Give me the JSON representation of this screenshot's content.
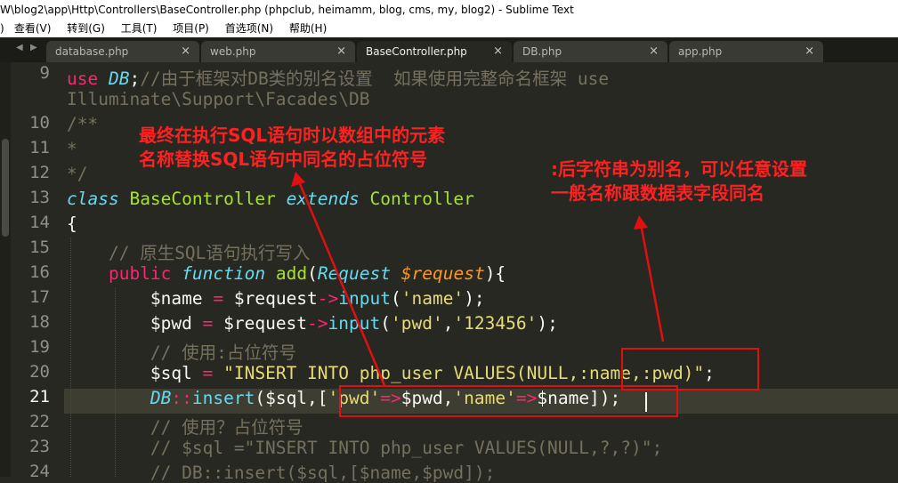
{
  "window": {
    "title": "W\\blog2\\app\\Http\\Controllers\\BaseController.php (phpclub, heimamm, blog, cms, my, blog2) - Sublime Text"
  },
  "menu": {
    "lead": ")",
    "items": [
      "查看(V)",
      "转到(G)",
      "工具(T)",
      "项目(P)",
      "首选项(N)",
      "帮助(H)"
    ]
  },
  "tabs": [
    {
      "label": "database.php",
      "close": "×"
    },
    {
      "label": "web.php",
      "close": "×"
    },
    {
      "label": "BaseController.php",
      "close": "×",
      "active": true
    },
    {
      "label": "DB.php",
      "close": "×"
    },
    {
      "label": "app.php",
      "close": "×"
    }
  ],
  "gutter": {
    "line_numbers": [
      "9",
      "",
      "10",
      "11",
      "12",
      "13",
      "14",
      "15",
      "16",
      "17",
      "18",
      "19",
      "20",
      "21",
      "22",
      "23",
      "24"
    ],
    "current_line": "21"
  },
  "code": {
    "lines": [
      [
        {
          "t": "use",
          "c": "k"
        },
        {
          "t": " "
        },
        {
          "t": "DB",
          "c": "t"
        },
        {
          "t": ";"
        },
        {
          "t": "//由于框架对DB类的别名设置  如果使用完整命名框架 use",
          "c": "c"
        }
      ],
      [
        {
          "t": "Illuminate\\Support\\Facades\\DB",
          "c": "c"
        }
      ],
      [
        {
          "t": "/**",
          "c": "c"
        }
      ],
      [
        {
          "t": "*",
          "c": "c"
        }
      ],
      [
        {
          "t": "*/",
          "c": "c"
        }
      ],
      [
        {
          "t": "class",
          "c": "t"
        },
        {
          "t": " "
        },
        {
          "t": "BaseController",
          "c": "g"
        },
        {
          "t": " "
        },
        {
          "t": "extends",
          "c": "t"
        },
        {
          "t": " "
        },
        {
          "t": "Controller",
          "c": "g"
        }
      ],
      [
        {
          "t": "{"
        }
      ],
      [
        {
          "t": "    "
        },
        {
          "t": "// 原生SQL语句执行写入",
          "c": "c"
        }
      ],
      [
        {
          "t": "    "
        },
        {
          "t": "public",
          "c": "k"
        },
        {
          "t": " "
        },
        {
          "t": "function",
          "c": "t"
        },
        {
          "t": " "
        },
        {
          "t": "add",
          "c": "g"
        },
        {
          "t": "("
        },
        {
          "t": "Request",
          "c": "t"
        },
        {
          "t": " "
        },
        {
          "t": "$request",
          "c": "p"
        },
        {
          "t": "){"
        }
      ],
      [
        {
          "t": "        $name "
        },
        {
          "t": "=",
          "c": "k"
        },
        {
          "t": " $request"
        },
        {
          "t": "->",
          "c": "k"
        },
        {
          "t": "input",
          "c": "f"
        },
        {
          "t": "("
        },
        {
          "t": "'name'",
          "c": "s"
        },
        {
          "t": ");"
        }
      ],
      [
        {
          "t": "        $pwd "
        },
        {
          "t": "=",
          "c": "k"
        },
        {
          "t": " $request"
        },
        {
          "t": "->",
          "c": "k"
        },
        {
          "t": "input",
          "c": "f"
        },
        {
          "t": "("
        },
        {
          "t": "'pwd'",
          "c": "s"
        },
        {
          "t": ","
        },
        {
          "t": "'123456'",
          "c": "s"
        },
        {
          "t": ");"
        }
      ],
      [
        {
          "t": "        "
        },
        {
          "t": "// 使用:占位符号",
          "c": "c"
        }
      ],
      [
        {
          "t": "        $sql "
        },
        {
          "t": "=",
          "c": "k"
        },
        {
          "t": " "
        },
        {
          "t": "\"INSERT INTO php_user VALUES(NULL,:name,:pwd)\"",
          "c": "s"
        },
        {
          "t": ";"
        }
      ],
      [
        {
          "t": "        "
        },
        {
          "t": "DB",
          "c": "t"
        },
        {
          "t": "::",
          "c": "k"
        },
        {
          "t": "insert",
          "c": "f"
        },
        {
          "t": "($sql,["
        },
        {
          "t": "'pwd'",
          "c": "s"
        },
        {
          "t": "=>",
          "c": "k"
        },
        {
          "t": "$pwd,"
        },
        {
          "t": "'name'",
          "c": "s"
        },
        {
          "t": "=>",
          "c": "k"
        },
        {
          "t": "$name]);"
        }
      ],
      [
        {
          "t": "        "
        },
        {
          "t": "// 使用？占位符号",
          "c": "c"
        }
      ],
      [
        {
          "t": "        "
        },
        {
          "t": "// $sql =\"INSERT INTO php_user VALUES(NULL,?,?)\";",
          "c": "c"
        }
      ],
      [
        {
          "t": "        "
        },
        {
          "t": "// DB::insert($sql,[$name,$pwd]);",
          "c": "c"
        }
      ]
    ]
  },
  "annotations": {
    "left_note": [
      "最终在执行SQL语句时以数组中的元素",
      "名称替换SQL语句中同名的占位符号"
    ],
    "right_note": [
      ":后字符串为别名，可以任意设置",
      "一般名称跟数据表字段同名"
    ],
    "arrow_color": "#e01010"
  }
}
